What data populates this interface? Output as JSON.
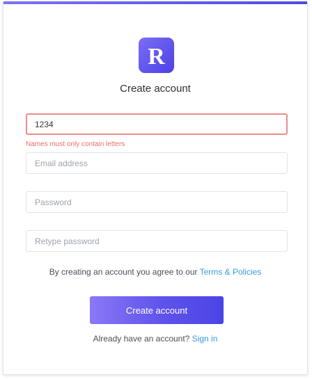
{
  "logo": {
    "letter": "R"
  },
  "form": {
    "title": "Create account",
    "name_value": "1234",
    "name_error": "Names must only contain letters",
    "email_placeholder": "Email address",
    "password_placeholder": "Password",
    "retype_placeholder": "Retype password",
    "terms_prefix": "By creating an account you agree to our ",
    "terms_link": "Terms & Policies",
    "submit_label": "Create account",
    "signin_prefix": "Already have an account? ",
    "signin_link": "Sign in"
  },
  "colors": {
    "accent": "#5e52ea",
    "error": "#f06b6b",
    "link": "#3b9ad9"
  }
}
